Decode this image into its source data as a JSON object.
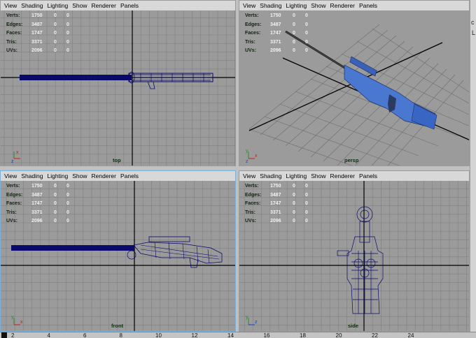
{
  "menu": [
    "View",
    "Shading",
    "Lighting",
    "Show",
    "Renderer",
    "Panels"
  ],
  "hud": [
    {
      "label": "Verts:",
      "value": "1750",
      "c1": "0",
      "c2": "0"
    },
    {
      "label": "Edges:",
      "value": "3487",
      "c1": "0",
      "c2": "0"
    },
    {
      "label": "Faces:",
      "value": "1747",
      "c1": "0",
      "c2": "0"
    },
    {
      "label": "Tris:",
      "value": "3371",
      "c1": "0",
      "c2": "0"
    },
    {
      "label": "UVs:",
      "value": "2096",
      "c1": "0",
      "c2": "0"
    }
  ],
  "viewports": [
    {
      "name": "top"
    },
    {
      "name": "persp"
    },
    {
      "name": "front"
    },
    {
      "name": "side"
    }
  ],
  "axis_labels": {
    "x": "x",
    "y": "y",
    "z": "z"
  },
  "right_strip": {
    "c": "c",
    "u": "L"
  },
  "timeline": [
    "2",
    "4",
    "6",
    "8",
    "10",
    "12",
    "14",
    "16",
    "18",
    "20",
    "22",
    "24"
  ],
  "colors": {
    "viewport_bg": "#9b9b9b",
    "grid": "#808080",
    "axis_line": "#000000",
    "wire": "#0a0a6a",
    "mesh_blue": "#4a78d0"
  }
}
